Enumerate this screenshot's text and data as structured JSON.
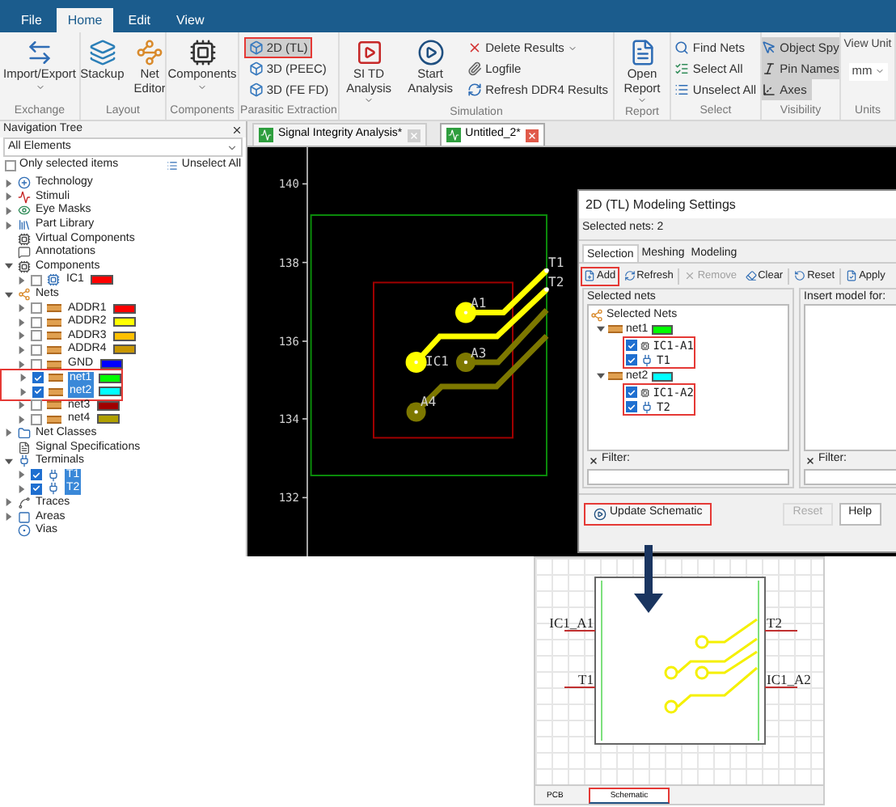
{
  "menu": [
    {
      "label": "File",
      "selected": false
    },
    {
      "label": "Home",
      "selected": true
    },
    {
      "label": "Edit",
      "selected": false
    },
    {
      "label": "View",
      "selected": false
    }
  ],
  "ribbon": [
    {
      "label": "Exchange",
      "buttons": [
        {
          "kind": "large",
          "label": "Import/Export",
          "dropdown": true
        }
      ]
    },
    {
      "label": "Layout",
      "buttons": [
        {
          "kind": "large",
          "label": "Stackup"
        },
        {
          "kind": "large",
          "label": "Net Editor"
        }
      ]
    },
    {
      "label": "Components",
      "buttons": [
        {
          "kind": "large",
          "label": "Components",
          "dropdown": true
        }
      ]
    },
    {
      "label": "Parasitic Extraction",
      "buttons": [
        {
          "kind": "small",
          "label": "2D (TL)",
          "on": true,
          "highlighted": true
        },
        {
          "kind": "small",
          "label": "3D (PEEC)",
          "on": false
        },
        {
          "kind": "small",
          "label": "3D (FE FD)",
          "on": false
        }
      ]
    },
    {
      "label": "Simulation",
      "buttons": [
        {
          "kind": "large",
          "label": "SI TD Analysis",
          "dropdown": true
        },
        {
          "kind": "large",
          "label": "Start Analysis"
        },
        {
          "kind": "small",
          "label": "Delete Results",
          "dropdown": true
        },
        {
          "kind": "small",
          "label": "Logfile"
        },
        {
          "kind": "small",
          "label": "Refresh DDR4 Results"
        }
      ]
    },
    {
      "label": "Report",
      "buttons": [
        {
          "kind": "large",
          "label": "Open Report",
          "dropdown": true
        }
      ]
    },
    {
      "label": "Select",
      "buttons": [
        {
          "kind": "small",
          "label": "Find Nets"
        },
        {
          "kind": "small",
          "label": "Select All"
        },
        {
          "kind": "small",
          "label": "Unselect All"
        }
      ]
    },
    {
      "label": "Visibility",
      "buttons": [
        {
          "kind": "small",
          "label": "Object Spy",
          "on": true
        },
        {
          "kind": "small",
          "label": "Pin Names",
          "on": true
        },
        {
          "kind": "small",
          "label": "Axes",
          "on": true
        }
      ]
    },
    {
      "label": "Units",
      "buttons": [
        {
          "kind": "caption",
          "label": "View Unit"
        },
        {
          "kind": "select",
          "label": "mm"
        }
      ]
    }
  ],
  "navigation": {
    "title": "Navigation Tree",
    "filter": "All Elements",
    "only_selected": {
      "label": "Only selected items",
      "checked": false
    },
    "unselect_all": "Unselect All",
    "tree": [
      {
        "label": "Technology",
        "expanded": false
      },
      {
        "label": "Stimuli",
        "expanded": false
      },
      {
        "label": "Eye Masks",
        "expanded": false
      },
      {
        "label": "Part Library",
        "expanded": false
      },
      {
        "label": "Virtual Components"
      },
      {
        "label": "Annotations"
      },
      {
        "label": "Components",
        "expanded": true,
        "children": [
          {
            "label": "IC1",
            "expanded": false,
            "checked": false,
            "selected": false,
            "highlighted": false,
            "color": "#ff0000"
          }
        ]
      },
      {
        "label": "Nets",
        "expanded": true,
        "children": [
          {
            "label": "ADDR1",
            "expanded": false,
            "checked": false,
            "selected": false,
            "highlighted": false,
            "color": "#ff0000"
          },
          {
            "label": "ADDR2",
            "expanded": false,
            "checked": false,
            "selected": false,
            "highlighted": false,
            "color": "#ffff00"
          },
          {
            "label": "ADDR3",
            "expanded": false,
            "checked": false,
            "selected": false,
            "highlighted": false,
            "color": "#ffc000"
          },
          {
            "label": "ADDR4",
            "expanded": false,
            "checked": false,
            "selected": false,
            "highlighted": false,
            "color": "#c89600"
          },
          {
            "label": "GND",
            "expanded": false,
            "checked": false,
            "selected": false,
            "highlighted": false,
            "color": "#0000ff"
          },
          {
            "label": "net1",
            "expanded": false,
            "checked": true,
            "selected": true,
            "highlighted": true,
            "color": "#00ff00"
          },
          {
            "label": "net2",
            "expanded": false,
            "checked": true,
            "selected": true,
            "highlighted": true,
            "color": "#00ffff"
          },
          {
            "label": "net3",
            "expanded": false,
            "checked": false,
            "selected": false,
            "highlighted": false,
            "color": "#a00000"
          },
          {
            "label": "net4",
            "expanded": false,
            "checked": false,
            "selected": false,
            "highlighted": false,
            "color": "#b0a000"
          }
        ]
      },
      {
        "label": "Net Classes",
        "expanded": false
      },
      {
        "label": "Signal Specifications"
      },
      {
        "label": "Terminals",
        "expanded": true,
        "children": [
          {
            "label": "T1",
            "expanded": false,
            "checked": true,
            "selected": true,
            "highlighted": false
          },
          {
            "label": "T2",
            "expanded": false,
            "checked": true,
            "selected": true,
            "highlighted": false
          }
        ]
      },
      {
        "label": "Traces",
        "expanded": false
      },
      {
        "label": "Areas",
        "expanded": false
      },
      {
        "label": "Vias"
      }
    ]
  },
  "document_tabs": [
    {
      "label": "Signal Integrity Analysis*",
      "selected": false
    },
    {
      "label": "Untitled_2*",
      "selected": true
    }
  ],
  "canvas": {
    "y_ticks": [
      "140",
      "138",
      "136",
      "134",
      "132"
    ],
    "component_label": "IC1",
    "pads": [
      {
        "label": "A1",
        "highlighted": true
      },
      {
        "highlighted": true
      },
      {
        "label": "A3",
        "highlighted": false
      },
      {
        "label": "A4",
        "highlighted": false
      }
    ],
    "terminals": [
      {
        "label": "T1"
      },
      {
        "label": "T2"
      }
    ]
  },
  "dialog": {
    "title": "2D (TL) Modeling Settings",
    "summary": "Selected nets: 2",
    "tabs": [
      {
        "label": "Selection",
        "selected": true
      },
      {
        "label": "Meshing",
        "selected": false
      },
      {
        "label": "Modeling",
        "selected": false
      }
    ],
    "toolbar": [
      {
        "label": "Add",
        "disabled": false,
        "highlighted": true
      },
      {
        "label": "Refresh",
        "disabled": false
      },
      {
        "label": "Remove",
        "disabled": true
      },
      {
        "label": "Clear",
        "disabled": false
      },
      {
        "label": "Reset",
        "disabled": false
      },
      {
        "label": "Apply",
        "disabled": false
      }
    ],
    "selected_nets": {
      "title": "Selected nets",
      "root": "Selected Nets",
      "filter_label": "Filter:",
      "nets": [
        {
          "label": "net1",
          "expanded": true,
          "color": "#00ff00",
          "highlighted": true,
          "children": [
            {
              "label": "IC1-A1",
              "checked": true
            },
            {
              "label": "T1",
              "checked": true
            }
          ]
        },
        {
          "label": "net2",
          "expanded": true,
          "color": "#00ffff",
          "highlighted": true,
          "children": [
            {
              "label": "IC1-A2",
              "checked": true
            },
            {
              "label": "T2",
              "checked": true
            }
          ]
        }
      ]
    },
    "insert_model": {
      "title": "Insert model for:",
      "filter_label": "Filter:"
    },
    "footer": [
      {
        "label": "Update Schematic",
        "disabled": false,
        "highlighted": true
      },
      {
        "label": "Reset",
        "disabled": true
      },
      {
        "label": "Help",
        "disabled": false
      }
    ]
  },
  "schematic": {
    "pins_left": [
      "IC1_A1",
      "T1"
    ],
    "pins_right": [
      "T2",
      "IC1_A2"
    ],
    "tabs": [
      {
        "label": "PCB",
        "selected": false,
        "highlighted": false
      },
      {
        "label": "Schematic",
        "selected": true,
        "highlighted": true
      }
    ]
  }
}
